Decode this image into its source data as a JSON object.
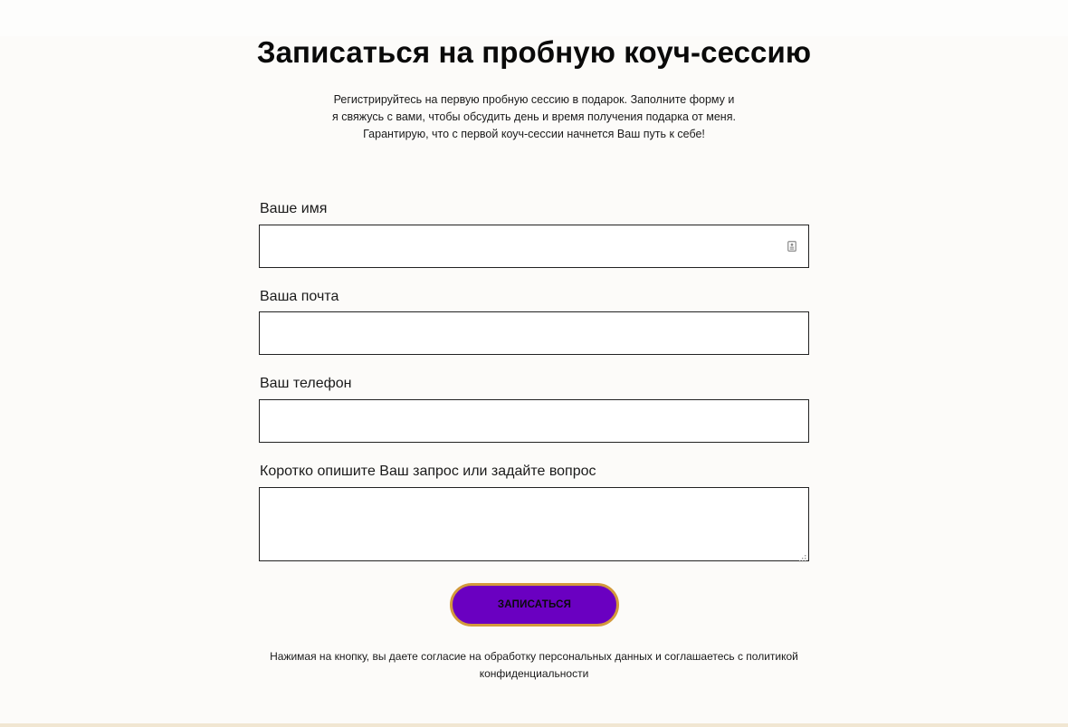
{
  "form": {
    "title": "Записаться на пробную коуч-сессию",
    "subtitle": "Регистрируйтесь на первую пробную сессию в подарок. Заполните форму и я свяжусь с вами, чтобы обсудить день и время получения подарка от меня. Гарантирую, что с первой коуч-сессии начнется Ваш путь к себе!",
    "fields": {
      "name": {
        "label": "Ваше имя",
        "value": ""
      },
      "email": {
        "label": "Ваша почта",
        "value": ""
      },
      "phone": {
        "label": "Ваш телефон",
        "value": ""
      },
      "message": {
        "label": "Коротко опишите Ваш запрос или задайте вопрос",
        "value": ""
      }
    },
    "submit_label": "ЗАПИСАТЬСЯ",
    "consent_text": "Нажимая на кнопку, вы даете согласие на обработку персональных данных и соглашаетесь с политикой конфиденциальности"
  },
  "icons": {
    "name_field_icon": "contact-card-icon",
    "textarea_grip": "resize-grip-icon"
  },
  "colors": {
    "background": "#fcfbf9",
    "button_fill": "#6a00c1",
    "button_border": "#d39a3c",
    "field_border": "#222222"
  }
}
